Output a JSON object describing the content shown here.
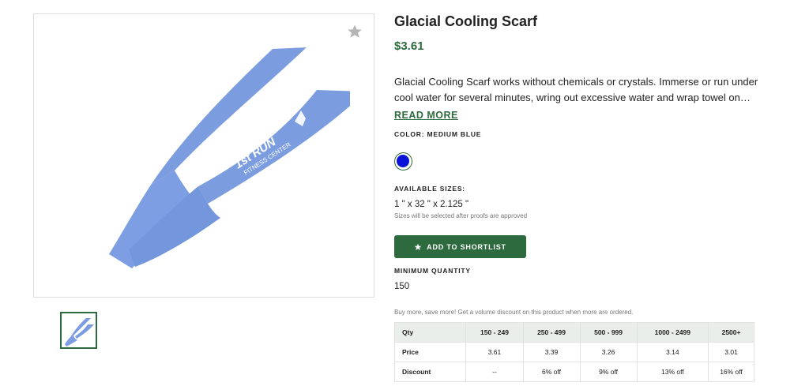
{
  "product": {
    "title": "Glacial Cooling Scarf",
    "price": "$3.61",
    "description": "Glacial Cooling Scarf works without chemicals or crystals. Immerse or run under cool water for several minutes, wring out excessive water and wrap towel on your neck - after a few snaps, you can feel the cooling effect.",
    "read_more": "READ MORE",
    "image_imprint": {
      "line1": "1st RUN",
      "line2": "FITNESS CENTER"
    }
  },
  "color": {
    "label": "COLOR: MEDIUM BLUE",
    "swatch_hex": "#0b14d6"
  },
  "sizes": {
    "label": "AVAILABLE SIZES:",
    "value": "1 \" x 32 \" x 2.125 \"",
    "note": "Sizes will be selected after proofs are approved"
  },
  "shortlist_button": {
    "label": "ADD TO SHORTLIST",
    "icon": "star-icon"
  },
  "min_quantity": {
    "label": "MINIMUM QUANTITY",
    "value": "150"
  },
  "discount_note": "Buy more, save more! Get a volume discount on this product when more are ordered.",
  "pricing_table": {
    "headers": [
      "Qty",
      "150 - 249",
      "250 - 499",
      "500 - 999",
      "1000 - 2499",
      "2500+"
    ],
    "rows": [
      {
        "label": "Price",
        "cells": [
          "3.61",
          "3.39",
          "3.26",
          "3.14",
          "3.01"
        ]
      },
      {
        "label": "Discount",
        "cells": [
          "--",
          "6% off",
          "9% off",
          "13% off",
          "16% off"
        ]
      }
    ]
  },
  "colors": {
    "accent": "#2d6a3e",
    "scarf": "#7b9de0",
    "scarf_dark": "#6d8fd6"
  }
}
